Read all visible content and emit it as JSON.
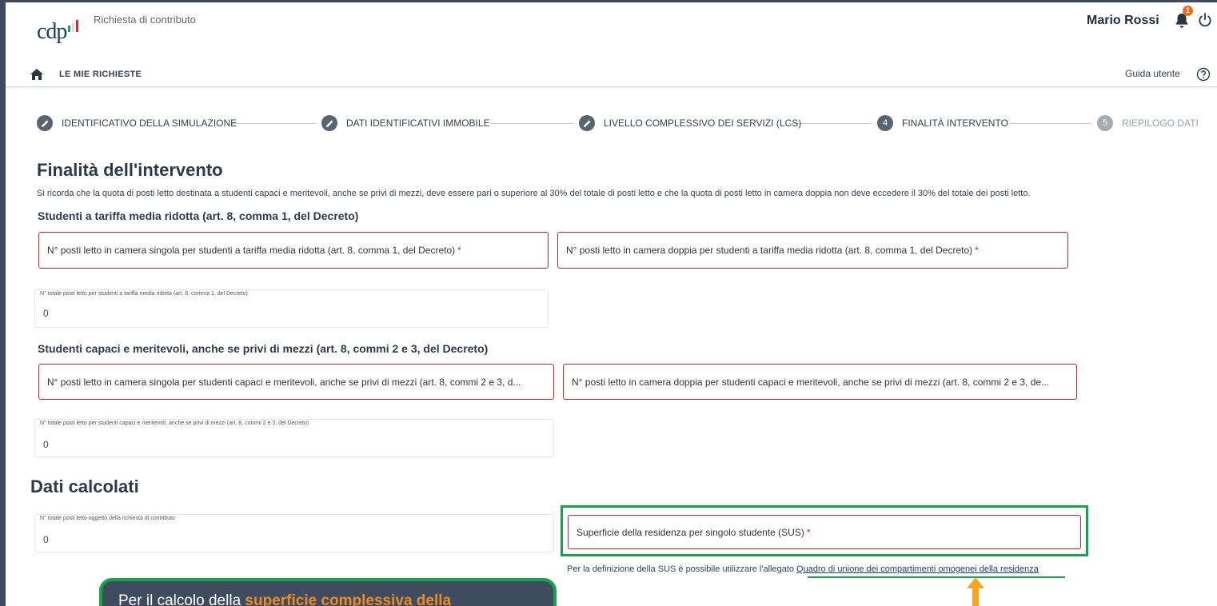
{
  "header": {
    "logo_text": "cdp",
    "app_title": "Richiesta di contributo",
    "user_name": "Mario Rossi",
    "notification_count": "1"
  },
  "nav": {
    "home_label": "LE MIE RICHIESTE",
    "guide_label": "Guida utente"
  },
  "stepper": {
    "steps": [
      {
        "label": "IDENTIFICATIVO DELLA SIMULAZIONE",
        "marker": ""
      },
      {
        "label": "DATI IDENTIFICATIVI IMMOBILE",
        "marker": ""
      },
      {
        "label": "LIVELLO COMPLESSIVO DEI SERVIZI (LCS)",
        "marker": ""
      },
      {
        "label": "FINALITÀ INTERVENTO",
        "marker": "4"
      },
      {
        "label": "RIEPILOGO DATI",
        "marker": "5"
      }
    ]
  },
  "main": {
    "title": "Finalità dell'intervento",
    "intro": "Si ricorda che la quota di posti letto destinata a studenti capaci e meritevoli, anche se privi di mezzi, deve essere pari o superiore al 30% del totale di posti letto e che la quota di posti letto in camera doppia non deve eccedere il 30% del totale dei posti letto.",
    "section1": {
      "title": "Studenti a tariffa media ridotta (art. 8, comma 1, del Decreto)",
      "single_placeholder": "N° posti letto in camera singola per studenti a tariffa media ridotta (art. 8, comma 1, del Decreto)",
      "double_placeholder": "N° posti letto in camera doppia per studenti a tariffa media ridotta (art. 8, comma 1, del Decreto)",
      "total_label": "N° totale posti letto per studenti a tariffa media ridotta (art. 8, comma 1, del Decreto)",
      "total_value": "0"
    },
    "section2": {
      "title": "Studenti capaci e meritevoli, anche se privi di mezzi (art. 8, commi 2 e 3, del Decreto)",
      "single_placeholder": "N° posti letto in camera singola per studenti capaci e meritevoli, anche se privi di mezzi (art. 8, commi 2 e 3, d...",
      "double_placeholder": "N° posti letto in camera doppia per studenti capaci e meritevoli, anche se privi di mezzi (art. 8, commi 2 e 3, de...",
      "total_label": "N° totale posti letto per studenti capaci e meritevoli, anche se privi di mezzi (art. 8, commi 2 e 3, del Decreto)",
      "total_value": "0"
    },
    "required_mark": "*"
  },
  "computed": {
    "title": "Dati calcolati",
    "total_label": "N° totale posti letto oggetto della richiesta di contributo",
    "total_value": "0",
    "sus_placeholder": "Superficie della residenza per singolo studente (SUS)",
    "sus_note_prefix": "Per la definizione della SUS è possibile utilizzare l'allegato ",
    "sus_note_link": "Quadro di unione dei compartimenti omogenei della residenza"
  },
  "tooltip": {
    "text_prefix": "Per il calcolo della ",
    "text_highlight": "superficie complessiva della"
  },
  "colors": {
    "required_border": "#c8242f",
    "highlight_green": "#17a34a",
    "tooltip_bg": "#3f4c5e",
    "tooltip_highlight": "#f08a24",
    "arrow": "#f5a623"
  }
}
